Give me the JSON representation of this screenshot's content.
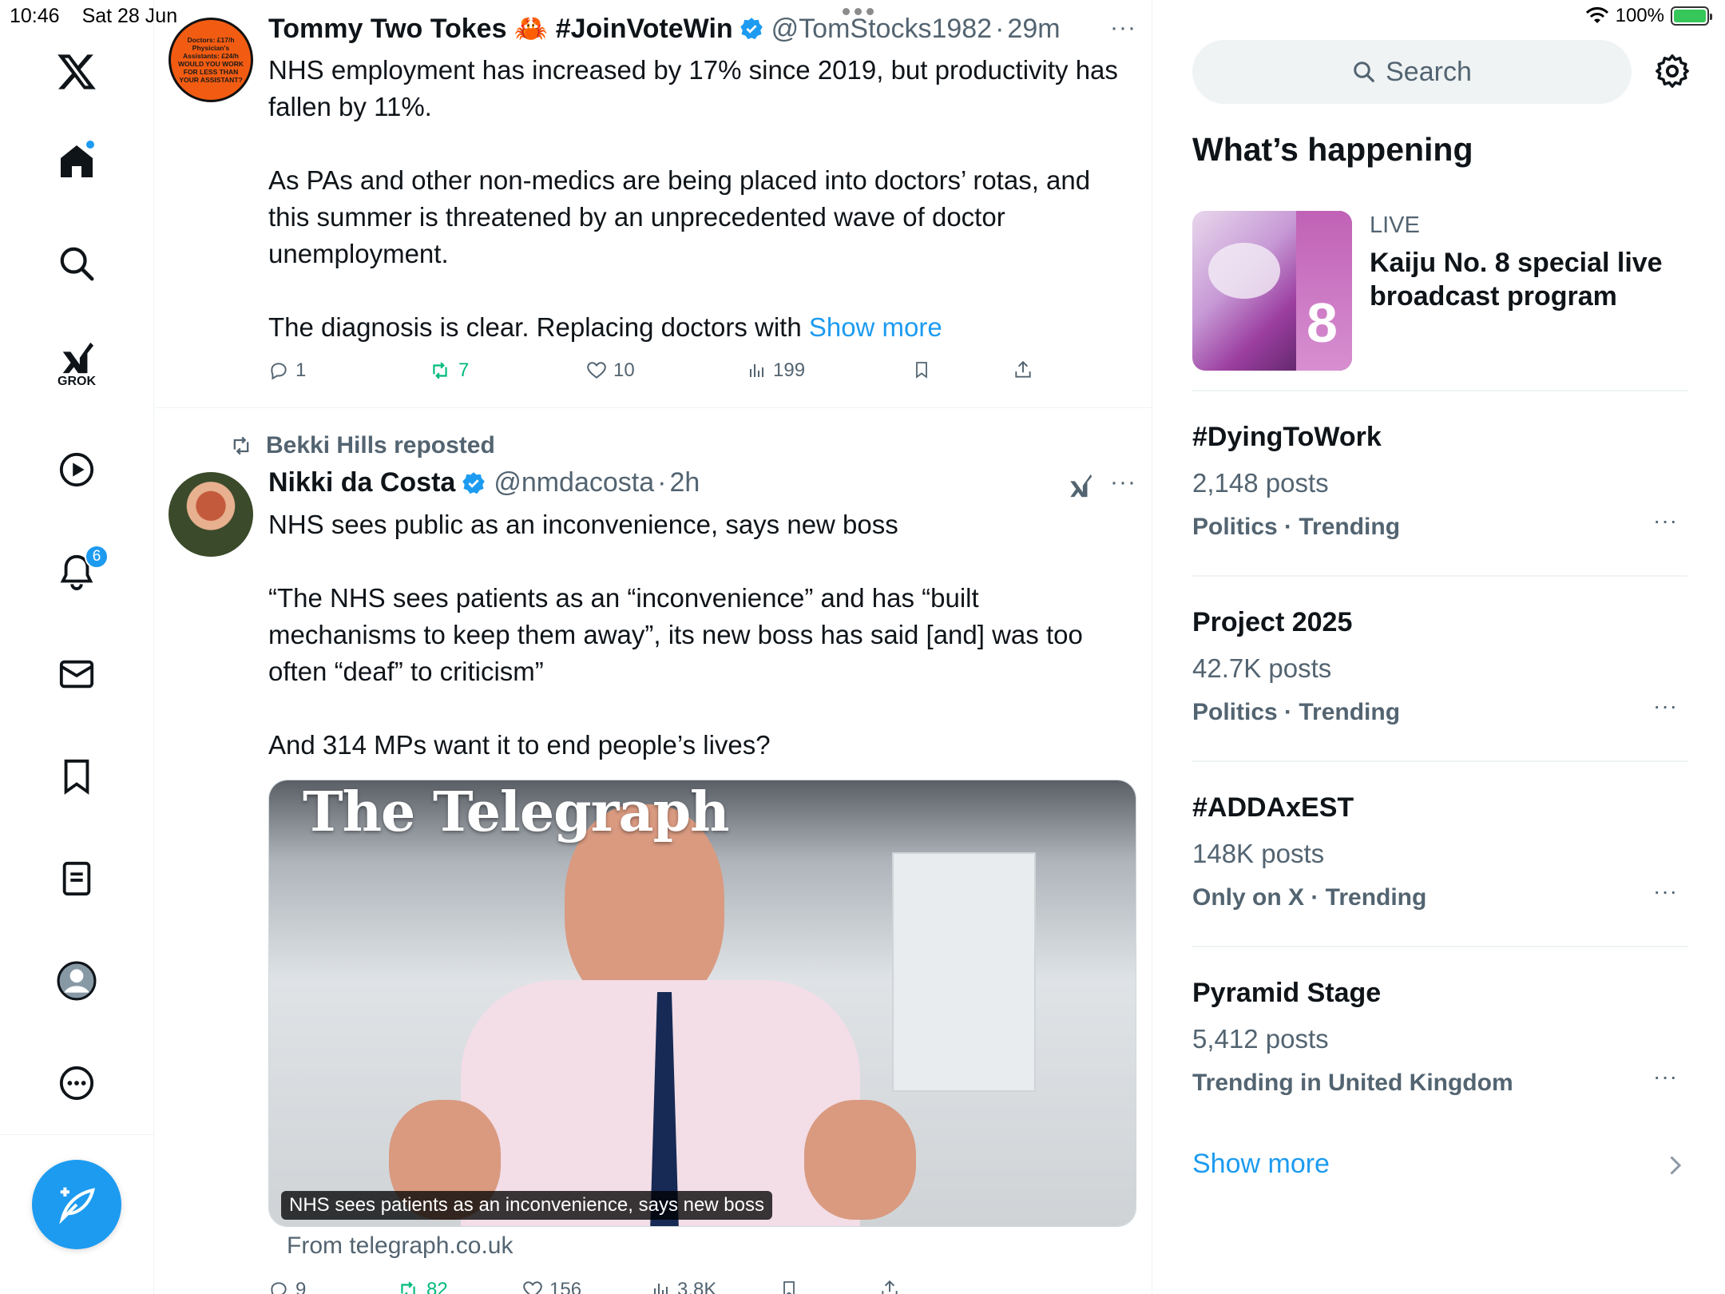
{
  "status_bar": {
    "time": "10:46",
    "date": "Sat 28 Jun",
    "battery": "100%"
  },
  "nav": {
    "grok_label": "GROK",
    "notifications_badge": "6",
    "items": [
      "x-logo",
      "home-icon",
      "search-icon",
      "grok-icon",
      "video-icon",
      "bell-icon",
      "mail-icon",
      "bookmark-icon",
      "lists-icon",
      "profile-icon",
      "more-icon"
    ]
  },
  "feed": {
    "post1": {
      "name": "Tommy Two Tokes 🦀 #JoinVoteWin",
      "handle": "@TomStocks1982",
      "time": "29m",
      "avatar_text": "Doctors: £17/h Physician's Assistants: £24/h WOULD YOU WORK FOR LESS THAN YOUR ASSISTANT?",
      "paragraphs": [
        "NHS employment has increased by 17% since 2019, but productivity has fallen by 11%.",
        "As PAs and other non-medics are being placed into doctors’ rotas, and this summer is threatened by an unprecedented wave of doctor unemployment."
      ],
      "last_line": "The diagnosis is clear. Replacing doctors with ",
      "show_more": "Show more",
      "replies": "1",
      "reposts": "7",
      "likes": "10",
      "views": "199"
    },
    "post2": {
      "repost_by": "Bekki Hills reposted",
      "name": "Nikki da Costa",
      "handle": "@nmdacosta",
      "time": "2h",
      "paragraphs": [
        "NHS sees public as an inconvenience, says new boss",
        "“The NHS sees patients as an “inconvenience” and has “built mechanisms to keep them away”, its new boss has said [and] was too often “deaf” to criticism”",
        "And 314 MPs want it to end people’s lives?"
      ],
      "card_masthead": "The Telegraph",
      "card_caption": "NHS sees patients as an inconvenience, says new boss",
      "card_from": "From telegraph.co.uk",
      "replies": "9",
      "reposts": "82",
      "likes": "156",
      "views": "3.8K"
    }
  },
  "sidebar": {
    "search_placeholder": "Search",
    "section_title": "What’s happening",
    "live": {
      "tag": "LIVE",
      "title": "Kaiju No. 8 special live broadcast program"
    },
    "trends": [
      {
        "title": "#DyingToWork",
        "count": "2,148 posts",
        "meta": "Politics · Trending"
      },
      {
        "title": "Project 2025",
        "count": "42.7K posts",
        "meta": "Politics · Trending"
      },
      {
        "title": "#ADDAxEST",
        "count": "148K posts",
        "meta": "Only on X · Trending"
      },
      {
        "title": "Pyramid Stage",
        "count": "5,412 posts",
        "meta": "Trending in United Kingdom"
      }
    ],
    "show_more": "Show more"
  },
  "colors": {
    "accent": "#1d9bf0",
    "text": "#0f1419",
    "muted": "#536471",
    "repost_green": "#00ba7c"
  }
}
